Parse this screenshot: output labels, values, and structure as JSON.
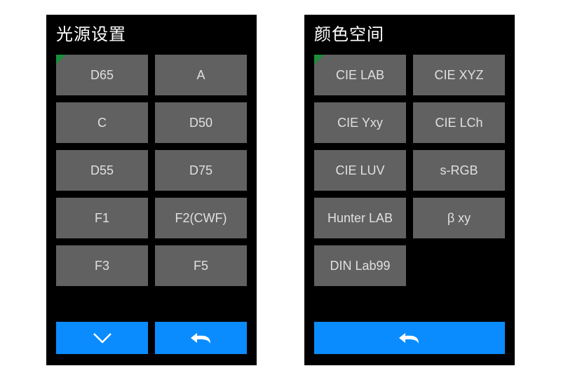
{
  "colors": {
    "accent": "#0a8cff",
    "corner": "#1c8f3c",
    "button_bg": "#616161"
  },
  "panels": [
    {
      "title": "光源设置",
      "options": [
        "D65",
        "A",
        "C",
        "D50",
        "D55",
        "D75",
        "F1",
        "F2(CWF)",
        "F3",
        "F5"
      ],
      "footer_buttons": [
        {
          "id": "more",
          "icon": "chevron-down-icon"
        },
        {
          "id": "back",
          "icon": "back-arrow-icon"
        }
      ]
    },
    {
      "title": "颜色空间",
      "options": [
        "CIE LAB",
        "CIE XYZ",
        "CIE Yxy",
        "CIE LCh",
        "CIE LUV",
        "s-RGB",
        "Hunter LAB",
        "β xy",
        "DIN Lab99"
      ],
      "footer_buttons": [
        {
          "id": "back",
          "icon": "back-arrow-icon",
          "full": true
        }
      ]
    }
  ]
}
